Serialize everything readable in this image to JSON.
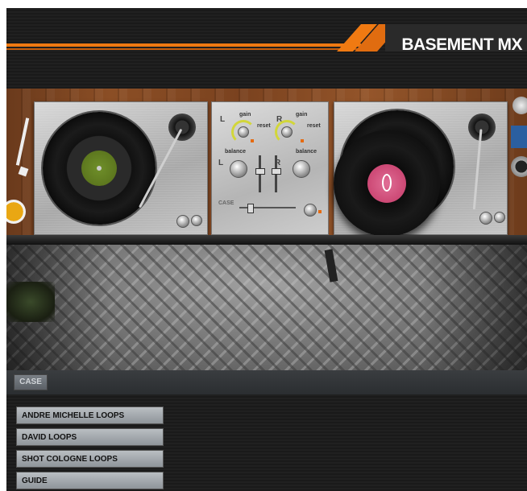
{
  "header": {
    "brand": "BASEMENT MX",
    "accent_color": "#f07a12"
  },
  "mixer": {
    "left_channel": "L",
    "right_channel": "R",
    "gain_label_left": "gain",
    "gain_label_right": "gain",
    "reset_label_left": "reset",
    "reset_label_right": "reset",
    "balance_label_left": "balance",
    "balance_label_right": "balance",
    "crossfader_label": "CASE"
  },
  "case": {
    "button_label": "CASE"
  },
  "loops_menu": {
    "items": [
      {
        "label": "ANDRE MICHELLE LOOPS"
      },
      {
        "label": "DAVID LOOPS"
      },
      {
        "label": "SHOT COLOGNE LOOPS"
      },
      {
        "label": "GUIDE"
      }
    ]
  },
  "decks": {
    "left_label_color": "#5e7d1c",
    "right_label_color": "#d2477a"
  }
}
